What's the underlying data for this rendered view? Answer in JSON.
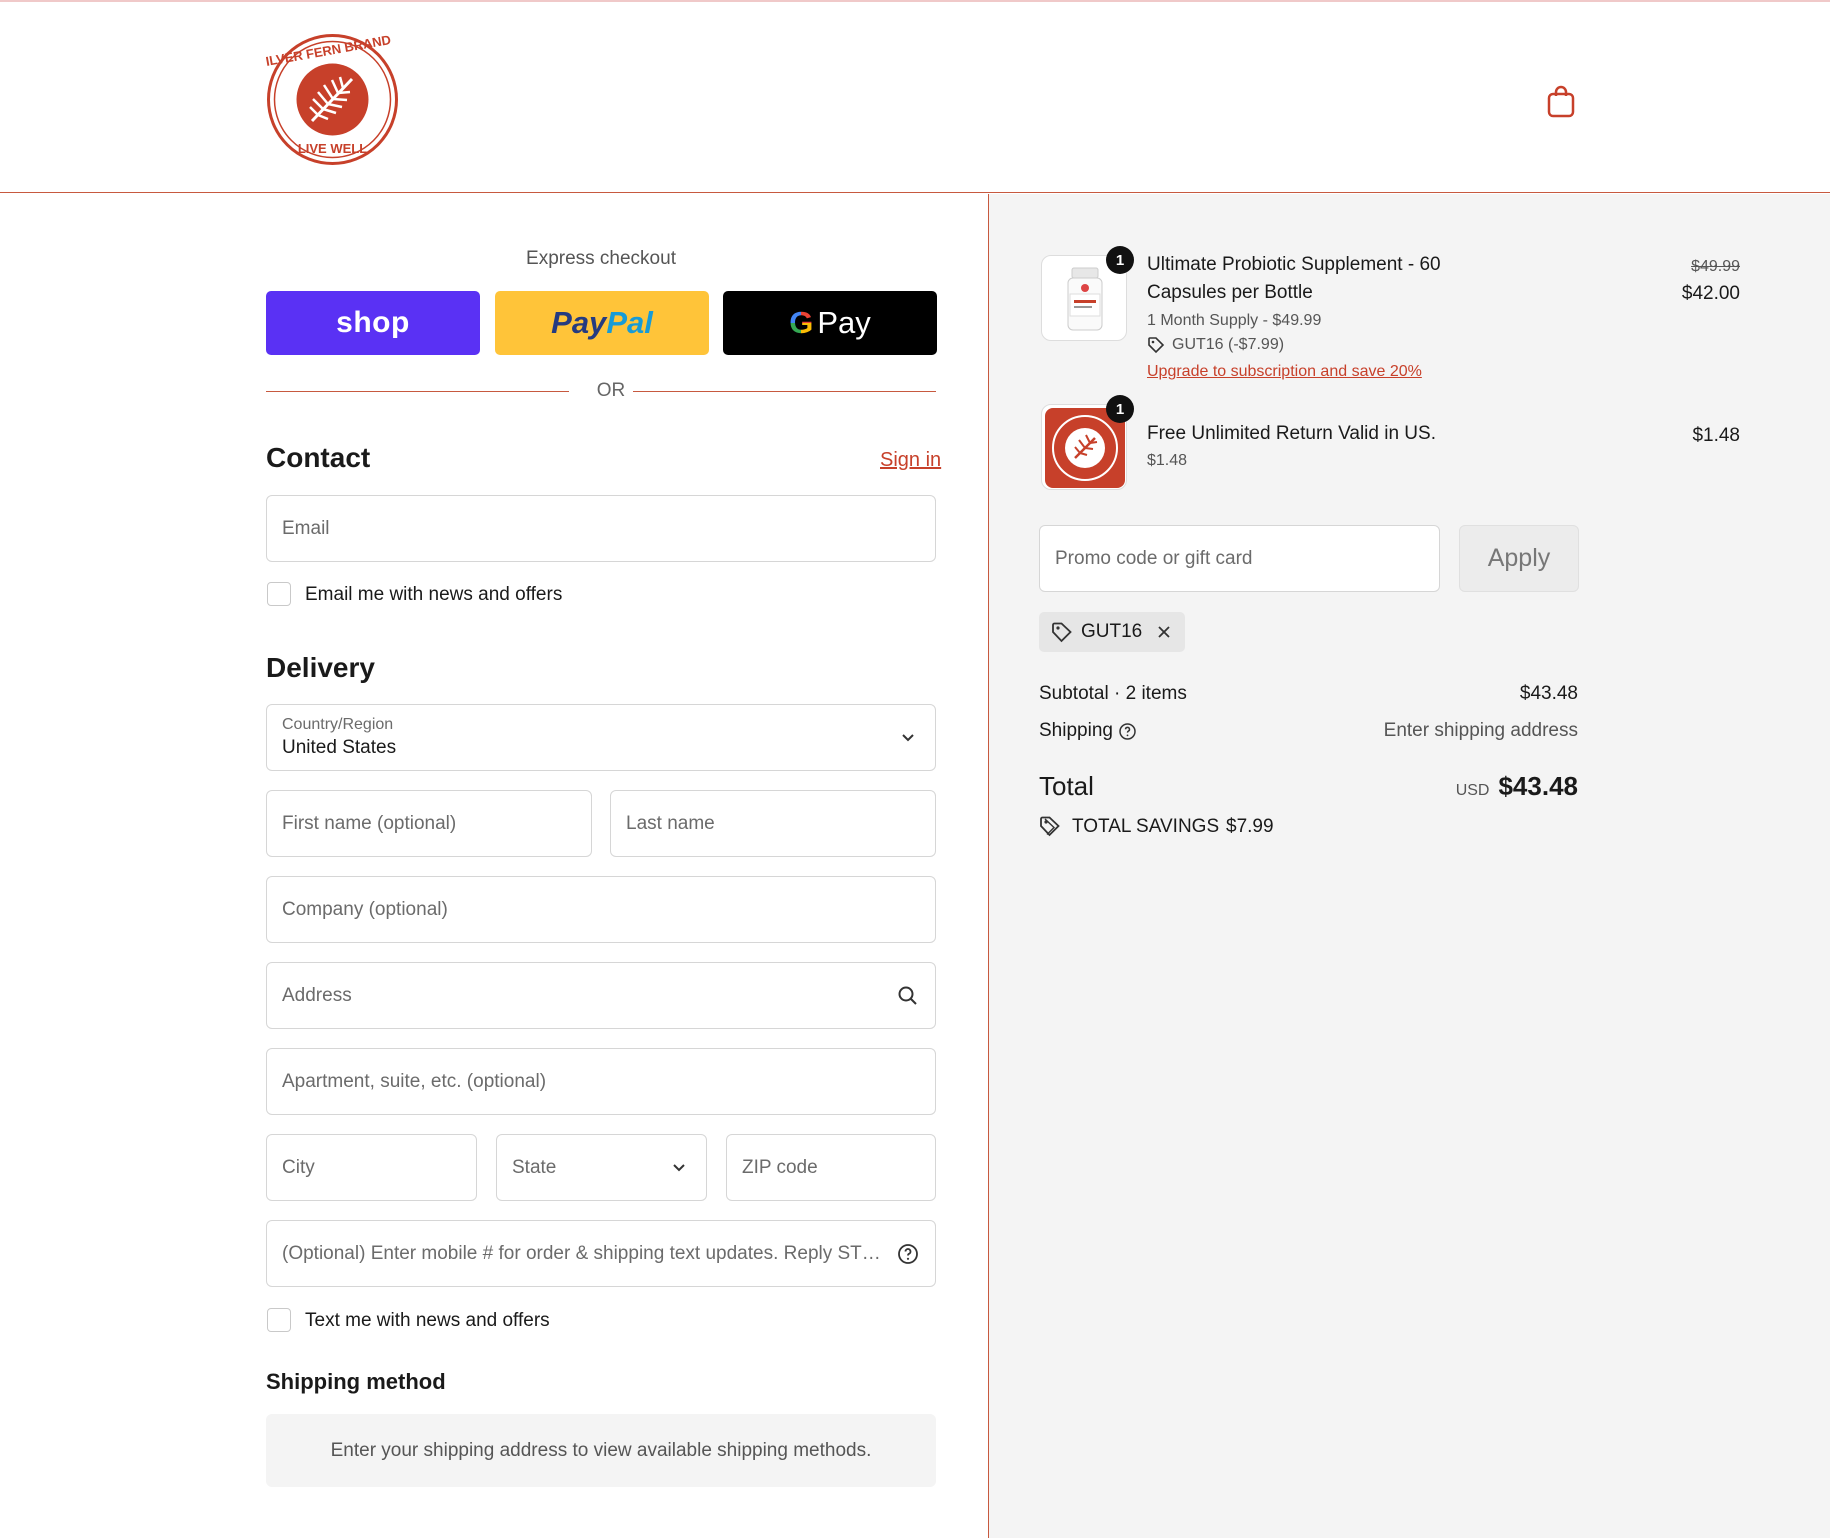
{
  "brand": {
    "logo_text": "SILVER FERN BRAND · LIVE WELL",
    "accent": "#c7402a",
    "border": "#c7593f"
  },
  "header": {
    "cart_icon": "shopping-bag-icon"
  },
  "express": {
    "title": "Express checkout",
    "shop_label": "shop",
    "paypal_label_1": "Pay",
    "paypal_label_2": "Pal",
    "gpay_label": "Pay",
    "or_label": "OR"
  },
  "contact": {
    "title": "Contact",
    "sign_in": "Sign in",
    "email_placeholder": "Email",
    "news_label": "Email me with news and offers"
  },
  "delivery": {
    "title": "Delivery",
    "country_label": "Country/Region",
    "country_value": "United States",
    "first_name": "First name (optional)",
    "last_name": "Last name",
    "company": "Company (optional)",
    "address": "Address",
    "apartment": "Apartment, suite, etc. (optional)",
    "city": "City",
    "state": "State",
    "zip": "ZIP code",
    "phone": "(Optional) Enter mobile # for order & shipping text updates. Reply ST…",
    "text_label": "Text me with news and offers"
  },
  "shipping": {
    "title": "Shipping method",
    "info": "Enter your shipping address to view available shipping methods."
  },
  "cart": {
    "items": [
      {
        "qty": "1",
        "name_line1": "Ultimate Probiotic Supplement - 60",
        "name_line2": "Capsules per Bottle",
        "variant": "1 Month Supply - $49.99",
        "discount": "GUT16 (-$7.99)",
        "upgrade": "Upgrade to subscription and save 20%",
        "original_price": "$49.99",
        "price": "$42.00"
      },
      {
        "qty": "1",
        "name": "Free Unlimited Return Valid in US.",
        "sub": "$1.48",
        "price": "$1.48"
      }
    ],
    "promo_placeholder": "Promo code or gift card",
    "apply_label": "Apply",
    "applied_code": "GUT16",
    "subtotal_label": "Subtotal · 2 items",
    "subtotal_value": "$43.48",
    "shipping_label": "Shipping",
    "shipping_value": "Enter shipping address",
    "total_label": "Total",
    "currency": "USD",
    "total_value": "$43.48",
    "savings_label": "TOTAL SAVINGS",
    "savings_value": "$7.99"
  }
}
